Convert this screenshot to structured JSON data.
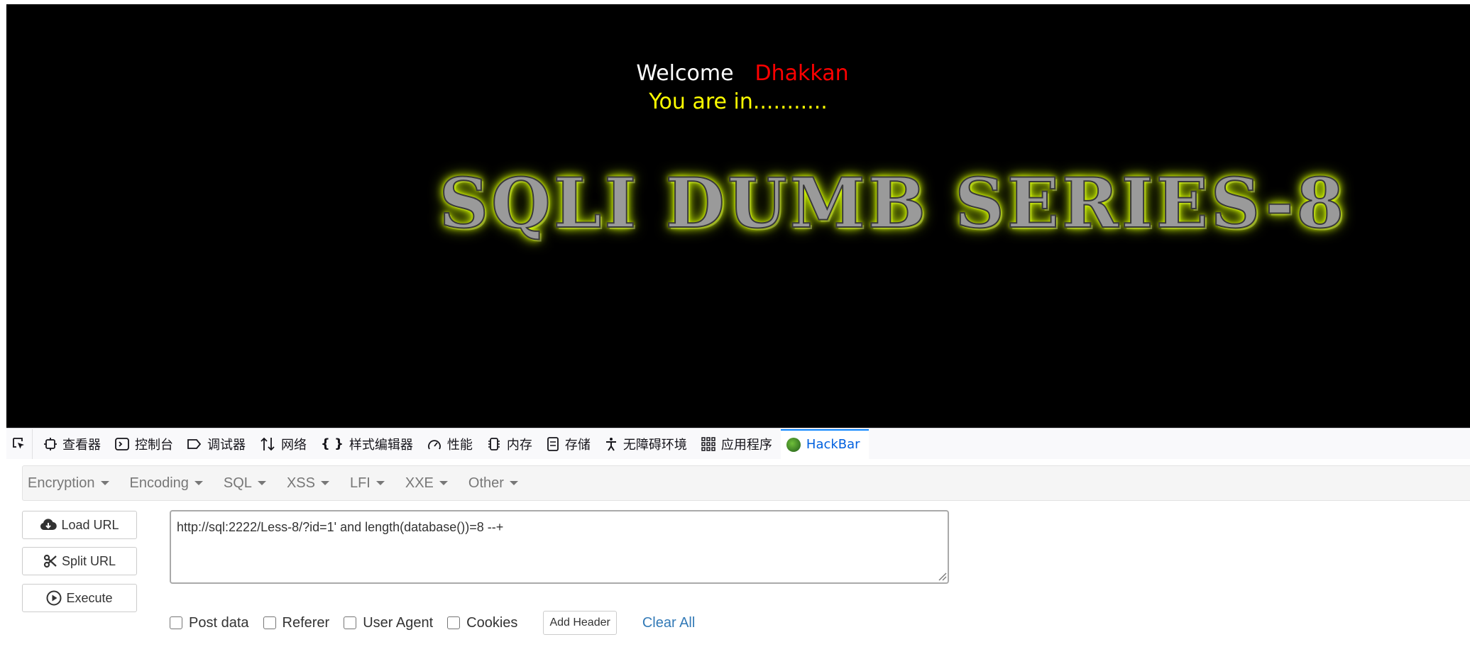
{
  "page": {
    "welcome_label": "Welcome",
    "user_name": "Dhakkan",
    "status_text": "You are in...........",
    "banner_title": "SQLI DUMB SERIES-8"
  },
  "devtools": {
    "tabs": [
      {
        "label": "查看器",
        "icon": "inspector-icon"
      },
      {
        "label": "控制台",
        "icon": "console-icon"
      },
      {
        "label": "调试器",
        "icon": "debugger-icon"
      },
      {
        "label": "网络",
        "icon": "network-icon"
      },
      {
        "label": "样式编辑器",
        "icon": "style-editor-icon"
      },
      {
        "label": "性能",
        "icon": "performance-icon"
      },
      {
        "label": "内存",
        "icon": "memory-icon"
      },
      {
        "label": "存储",
        "icon": "storage-icon"
      },
      {
        "label": "无障碍环境",
        "icon": "accessibility-icon"
      },
      {
        "label": "应用程序",
        "icon": "application-icon"
      },
      {
        "label": "HackBar",
        "icon": "hackbar-logo-icon",
        "active": true
      }
    ]
  },
  "hackbar": {
    "menu": [
      "Encryption",
      "Encoding",
      "SQL",
      "XSS",
      "LFI",
      "XXE",
      "Other"
    ],
    "buttons": {
      "load_url": "Load URL",
      "split_url": "Split URL",
      "execute": "Execute"
    },
    "url_value": "http://sql:2222/Less-8/?id=1' and length(database())=8 --+",
    "options": {
      "post_data": "Post data",
      "referer": "Referer",
      "user_agent": "User Agent",
      "cookies": "Cookies",
      "add_header": "Add Header",
      "clear_all": "Clear All"
    }
  },
  "colors": {
    "background": "#000000",
    "welcome": "#ffffff",
    "user_name": "#ff0000",
    "status": "#ffff00",
    "active_tab": "#0060df",
    "link": "#337ab7"
  }
}
